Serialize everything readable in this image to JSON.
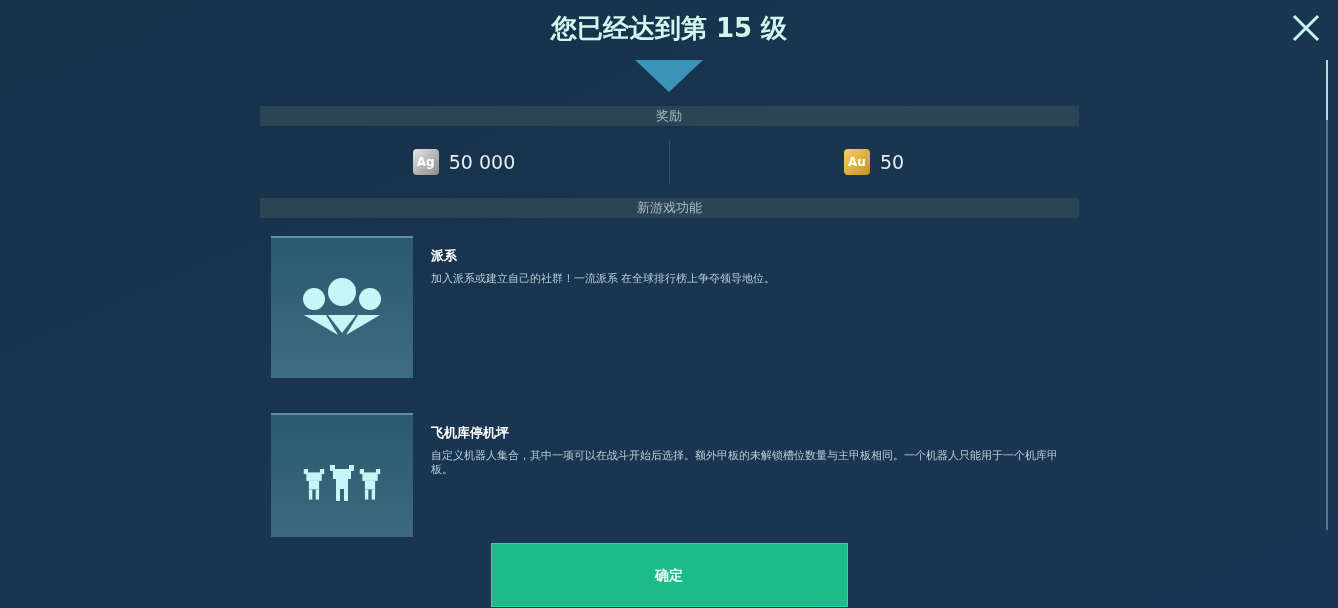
{
  "title": "您已经达到第 15 级",
  "rewards_header": "奖励",
  "rewards": [
    {
      "kind": "silver",
      "symbol": "Ag",
      "amount": "50 000"
    },
    {
      "kind": "gold",
      "symbol": "Au",
      "amount": "50"
    }
  ],
  "features_header": "新游戏功能",
  "features": [
    {
      "kind": "clan",
      "name": "派系",
      "description": "加入派系或建立自己的社群！一流派系 在全球排行榜上争夺领导地位。"
    },
    {
      "kind": "hangar",
      "name": "飞机库停机坪",
      "description": "自定义机器人集合，其中一项可以在战斗开始后选择。额外甲板的未解锁槽位数量与主甲板相同。一个机器人只能用于一个机库甲板。"
    }
  ],
  "confirm_button": "确定"
}
